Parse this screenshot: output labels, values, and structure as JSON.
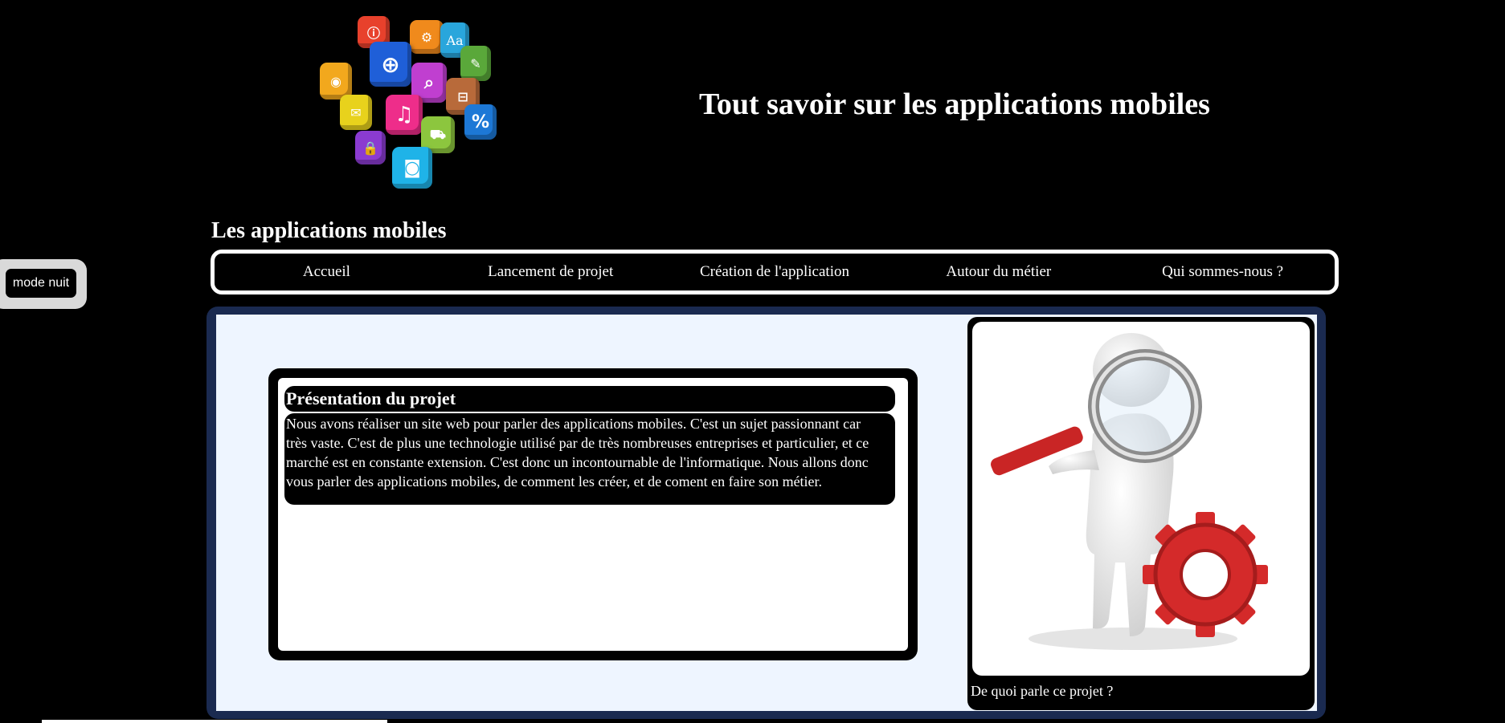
{
  "header": {
    "site_title": "Tout savoir sur les applications mobiles",
    "logo_icons": [
      "info-icon",
      "gear-icon",
      "font-icon",
      "globe-icon",
      "rss-icon",
      "search-icon",
      "lock-icon",
      "edit-icon",
      "mail-icon",
      "music-icon",
      "cart-icon",
      "percent-icon",
      "padlock-icon",
      "camera-icon"
    ]
  },
  "section_heading": "Les applications mobiles",
  "mode_button": {
    "label": "mode nuit"
  },
  "nav": {
    "items": [
      {
        "label": "Accueil"
      },
      {
        "label": "Lancement de projet"
      },
      {
        "label": "Création de l'application"
      },
      {
        "label": "Autour du métier"
      },
      {
        "label": "Qui sommes-nous ?"
      }
    ]
  },
  "main": {
    "card": {
      "title": "Présentation du projet",
      "text": "Nous avons réaliser un site web pour parler des applications mobiles. C'est un sujet passionnant car très vaste. C'est de plus une technologie utilisé par de très nombreuses entreprises et particulier, et ce marché est en constante extension. C'est donc un incontournable de l'informatique. Nous allons donc vous parler des applications mobiles, de comment les créer, et de coment en faire son métier."
    },
    "figure": {
      "caption": "De quoi parle ce projet ?",
      "image_icon": "magnifier-figure-with-gear-icon"
    }
  },
  "colors": {
    "background": "#000000",
    "main_frame": "#1a2a50",
    "main_panel": "#eef5ff",
    "text": "#ffffff",
    "gear_red": "#d42a2a"
  }
}
